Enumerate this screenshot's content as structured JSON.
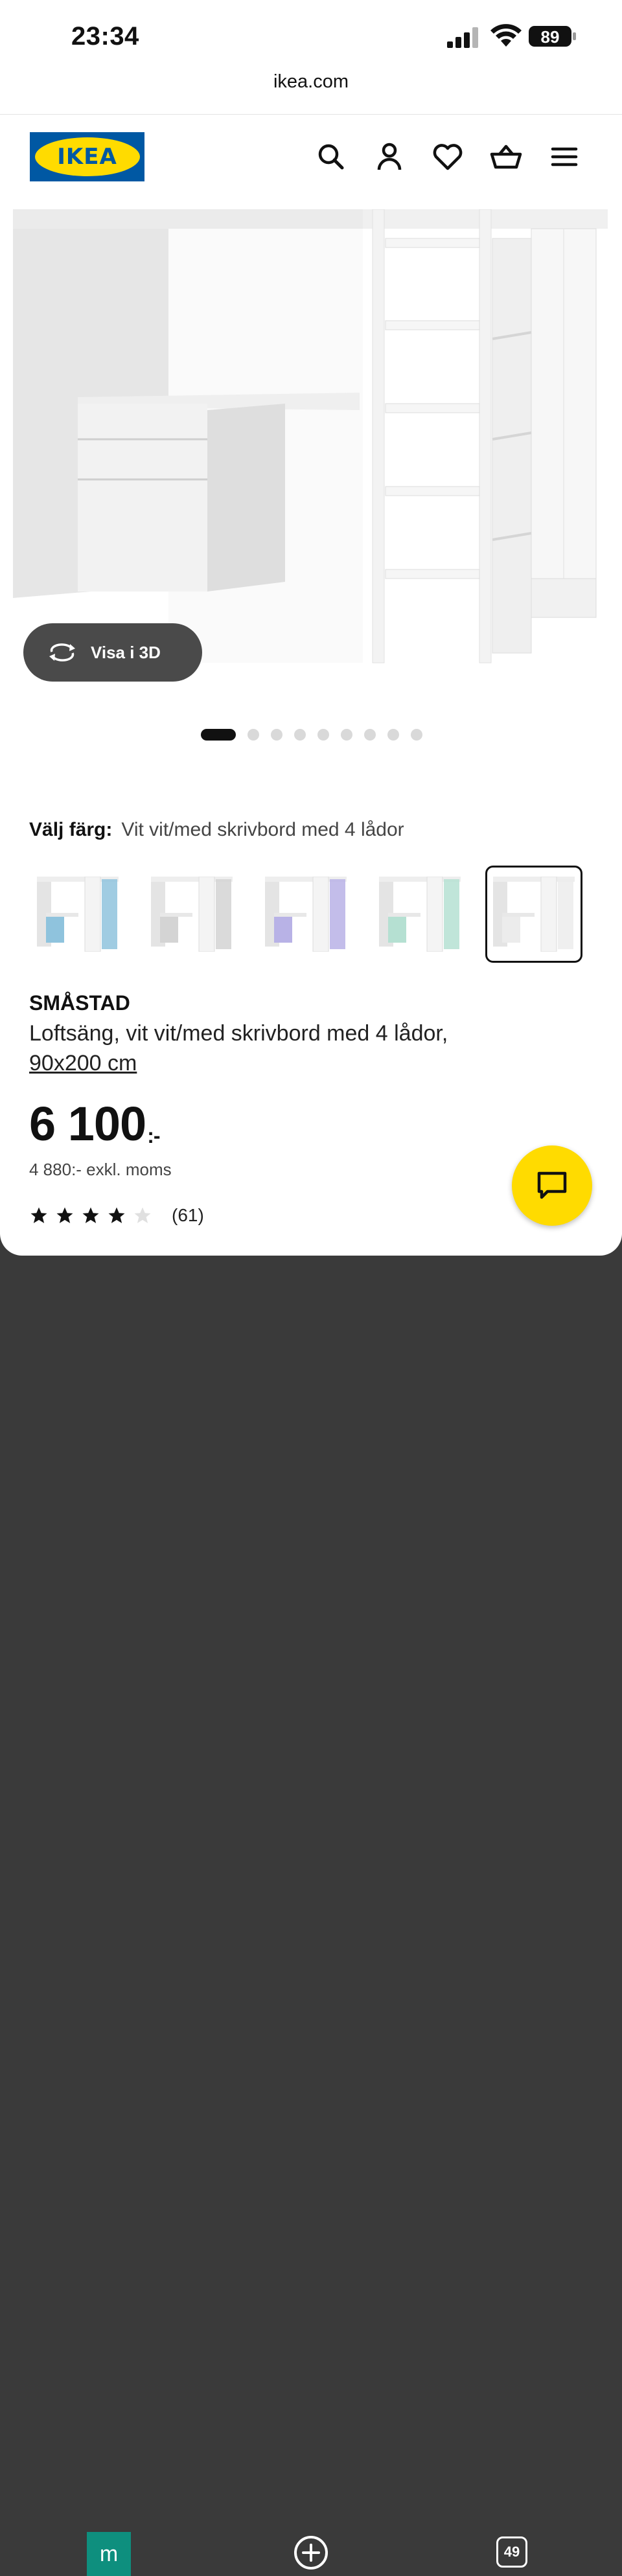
{
  "status_bar": {
    "time": "23:34",
    "battery": "89"
  },
  "browser": {
    "url": "ikea.com"
  },
  "header": {
    "logo_text": "IKEA",
    "icons": [
      "search-icon",
      "account-icon",
      "heart-icon",
      "cart-icon",
      "menu-icon"
    ]
  },
  "gallery": {
    "view_3d_label": "Visa i 3D",
    "image_count": 9,
    "active_index": 0
  },
  "color_picker": {
    "label": "Välj färg:",
    "value": "Vit vit/med skrivbord med 4 lådor",
    "swatches": [
      {
        "accent": "#8fc3dd",
        "selected": false
      },
      {
        "accent": "#d4d4d4",
        "selected": false
      },
      {
        "accent": "#b8b2e6",
        "selected": false
      },
      {
        "accent": "#b5e0d2",
        "selected": false
      },
      {
        "accent": "#ececec",
        "selected": true
      }
    ]
  },
  "product": {
    "name": "SMÅSTAD",
    "description": "Loftsäng, vit vit/med skrivbord med 4 lådor,",
    "size": "90x200 cm",
    "price": "6 100",
    "price_suffix": ":-",
    "price_excl": "4 880:- exkl. moms",
    "rating": 4,
    "rating_max": 5,
    "review_count": "(61)"
  },
  "bottom_bar": {
    "tab_letter": "m",
    "tab_count": "49"
  },
  "colors": {
    "ikea_blue": "#0058a3",
    "ikea_yellow": "#ffdb00",
    "teal": "#0e8f7e"
  }
}
